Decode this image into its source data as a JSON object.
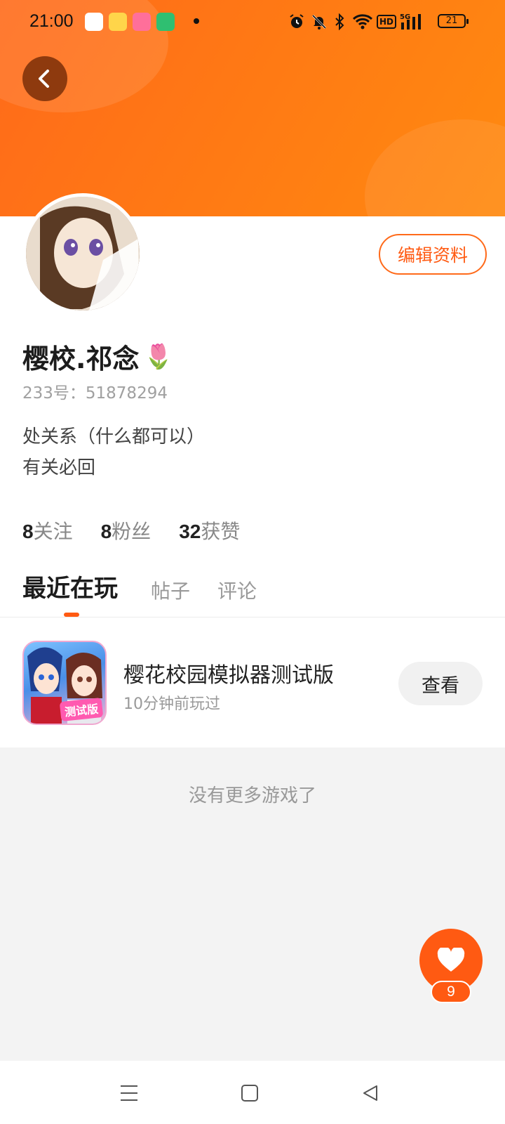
{
  "status_bar": {
    "time": "21:00",
    "battery": "21",
    "network": "5G",
    "hd_label": "HD",
    "icons": [
      "alarm-icon",
      "mute-icon",
      "bluetooth-icon",
      "wifi-icon",
      "hd-icon",
      "signal-icon",
      "battery-icon"
    ]
  },
  "header": {
    "back_icon": "chevron-left-icon",
    "accent_color": "#ff6a1a"
  },
  "profile": {
    "username": "樱校.祁念",
    "emoji": "🌷",
    "uid": "233号：51878294",
    "bio_line1": "处关系（什么都可以）",
    "bio_line2": "有关必回",
    "edit_label": "编辑资料",
    "stats": {
      "following_count": "8",
      "following_label": "关注",
      "followers_count": "8",
      "followers_label": "粉丝",
      "likes_count": "32",
      "likes_label": "获赞"
    }
  },
  "tabs": [
    {
      "label": "最近在玩",
      "active": true
    },
    {
      "label": "帖子",
      "active": false
    },
    {
      "label": "评论",
      "active": false
    }
  ],
  "recent_games": [
    {
      "title": "樱花校园模拟器测试版",
      "subtitle": "10分钟前玩过",
      "icon_tag": "测试版",
      "action_label": "查看"
    }
  ],
  "empty_message": "没有更多游戏了",
  "fab": {
    "icon": "heart-icon",
    "count": "9"
  }
}
